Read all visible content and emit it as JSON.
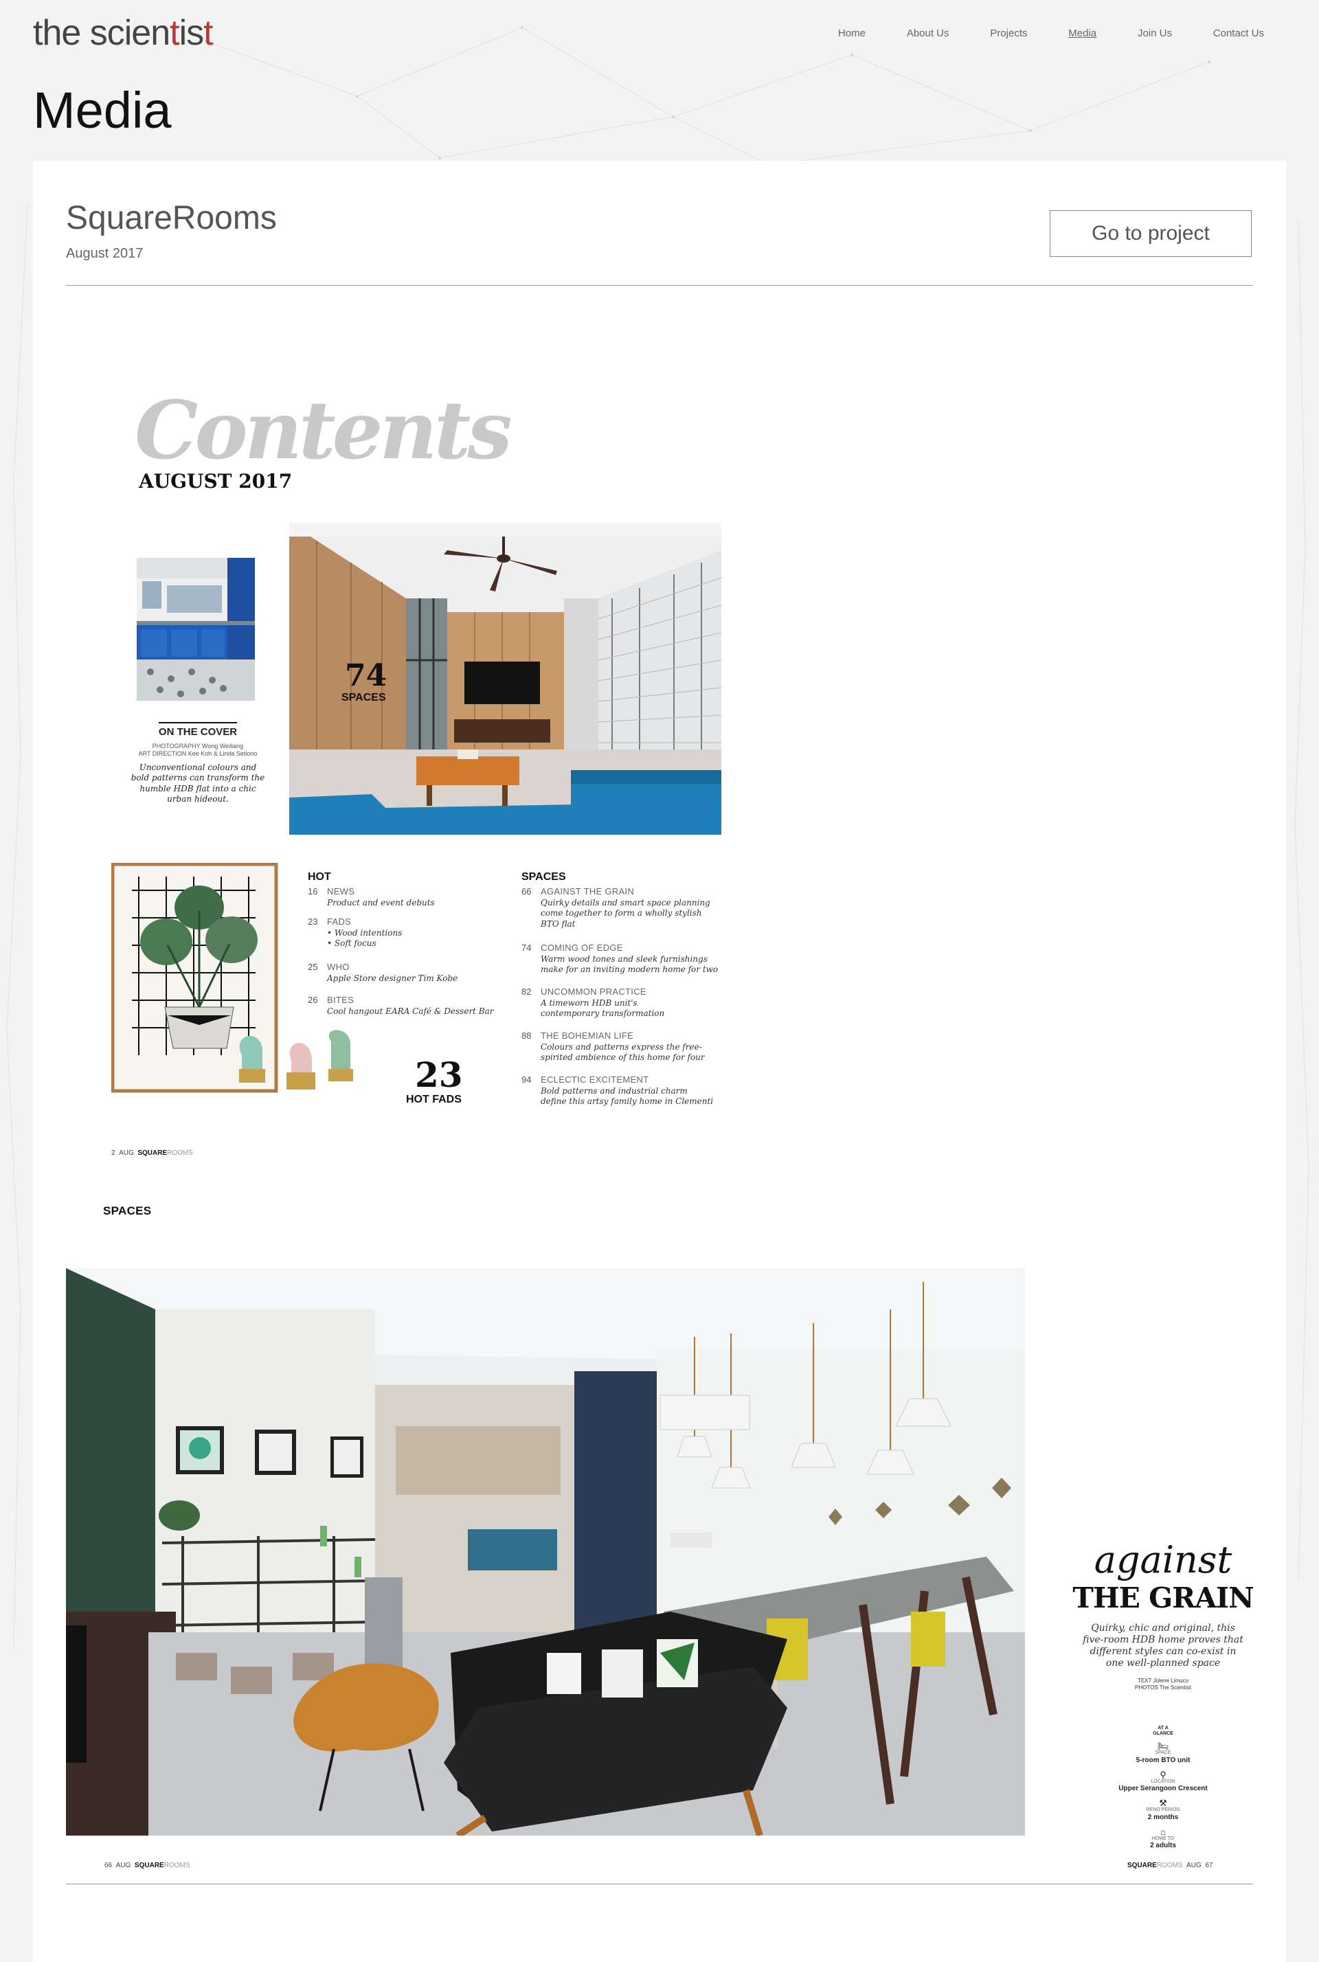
{
  "logo": {
    "before": "the scien",
    "t1": "t",
    "mid": "is",
    "t2": "t"
  },
  "nav": {
    "items": [
      "Home",
      "About Us",
      "Projects",
      "Media",
      "Join Us",
      "Contact Us"
    ]
  },
  "page_title": "Media",
  "project": {
    "title": "SquareRooms",
    "date": "August 2017",
    "button_label": "Go to project"
  },
  "magazine_page1": {
    "heading": "Contents",
    "issue": "AUGUST 2017",
    "on_cover": {
      "title": "ON THE COVER",
      "credit_line1": "PHOTOGRAPHY Wong Weiliang",
      "credit_line2": "ART DIRECTION Kee Koh & Linda Setiono",
      "description": "Unconventional colours and bold patterns can transform the humble HDB flat into a chic urban hideout."
    },
    "feature_num": "74",
    "feature_label": "SPACES",
    "hot_num": "23",
    "hot_label": "HOT FADS",
    "hot": {
      "heading": "HOT",
      "items": [
        {
          "num": "16",
          "name": "NEWS",
          "desc": "Product and event debuts"
        },
        {
          "num": "23",
          "name": "FADS",
          "desc": "• Wood intentions\n• Soft focus"
        },
        {
          "num": "25",
          "name": "WHO",
          "desc": "Apple Store designer Tim Kobe"
        },
        {
          "num": "26",
          "name": "BITES",
          "desc": "Cool hangout EARA Café & Dessert Bar"
        }
      ]
    },
    "spaces": {
      "heading": "SPACES",
      "items": [
        {
          "num": "66",
          "name": "AGAINST THE GRAIN",
          "desc": "Quirky details and smart space planning\ncome together to form a wholly stylish\nBTO flat"
        },
        {
          "num": "74",
          "name": "COMING OF EDGE",
          "desc": "Warm wood tones and sleek furnishings\nmake for an inviting modern home for two"
        },
        {
          "num": "82",
          "name": "UNCOMMON PRACTICE",
          "desc": "A timeworn HDB unit's\ncontemporary transformation"
        },
        {
          "num": "88",
          "name": "THE BOHEMIAN LIFE",
          "desc": "Colours and patterns express the free-\nspirited ambience of this home for four"
        },
        {
          "num": "94",
          "name": "ECLECTIC EXCITEMENT",
          "desc": "Bold patterns and industrial charm\ndefine this artsy family home in Clementi"
        }
      ]
    },
    "folio": {
      "page": "2",
      "month": "AUG",
      "brand_bold": "SQUARE",
      "brand_light": "ROOMS"
    }
  },
  "spread_label": "SPACES",
  "spread": {
    "title_script": "against",
    "title_bold": "THE GRAIN",
    "description": "Quirky, chic and original, this five-room HDB home proves that different styles can co-exist in one well-planned space",
    "credit_text": "TEXT Jolene Limuco",
    "credit_photos": "PHOTOS The Scientist",
    "glance_line1": "AT A",
    "glance_line2": "GLANCE",
    "glance": [
      {
        "icon": "bed-icon",
        "glyph": "🛏",
        "label": "SPACE",
        "value": "5-room BTO unit"
      },
      {
        "icon": "location-pin-icon",
        "glyph": "⚲",
        "label": "LOCATION",
        "value": "Upper Serangoon Crescent"
      },
      {
        "icon": "tools-icon",
        "glyph": "⚒",
        "label": "RENO PERIOD",
        "value": "2 months"
      },
      {
        "icon": "home-icon",
        "glyph": "⌂",
        "label": "HOME TO",
        "value": "2 adults"
      }
    ],
    "folio_left": {
      "page": "66",
      "month": "AUG",
      "brand_bold": "SQUARE",
      "brand_light": "ROOMS"
    },
    "folio_right": {
      "page": "67",
      "month": "AUG",
      "brand_bold": "SQUARE",
      "brand_light": "ROOMS"
    }
  },
  "colors": {
    "logo_accent": "#b23a3a",
    "sofa_blue": "#1f7fb8",
    "wall_green": "#2f4a3e"
  }
}
